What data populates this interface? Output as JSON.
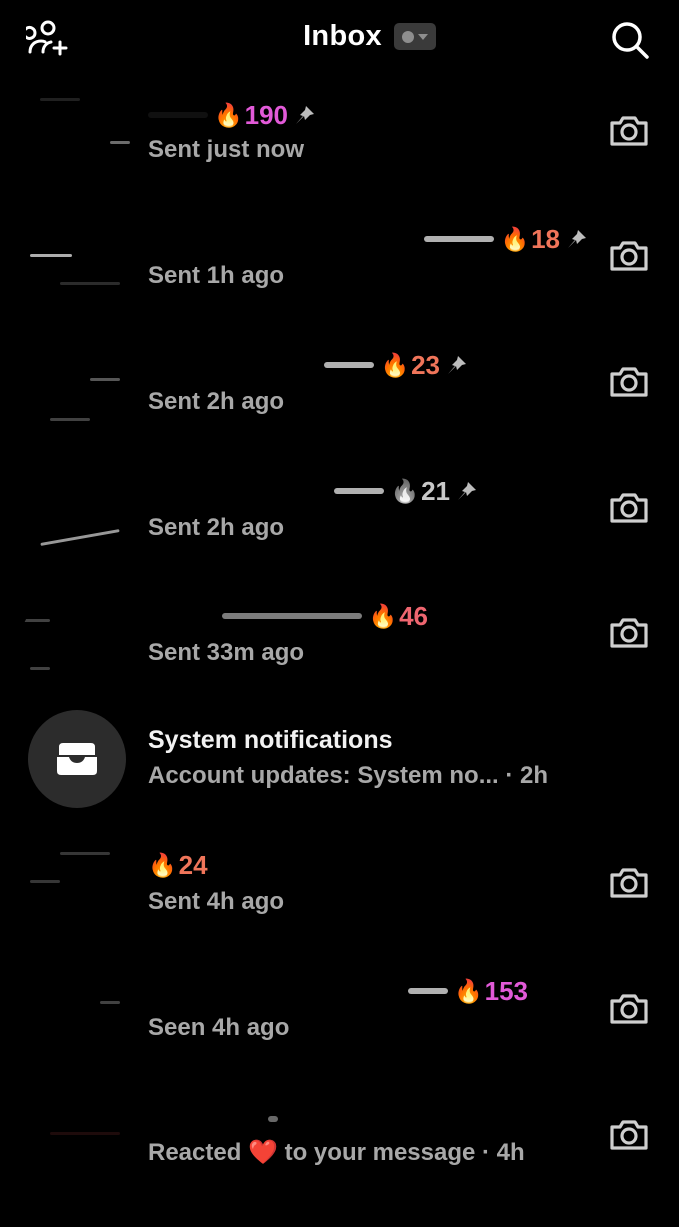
{
  "header": {
    "title": "Inbox",
    "icons": {
      "left": "add-friends-icon",
      "status": "online-status-dropdown",
      "right": "search-icon"
    }
  },
  "colors": {
    "background": "#000000",
    "secondary_text": "#a8a8a8",
    "streak_pink": "#e25ad8",
    "streak_orange": "#f0755a",
    "streak_coral": "#ef6670",
    "streak_gray": "#c8c8c8"
  },
  "conversations": [
    {
      "streak": "190",
      "streak_color": "#e25ad8",
      "flame": "🔥",
      "pinned": true,
      "status": "Sent just now",
      "camera": true
    },
    {
      "streak": "18",
      "streak_color": "#f0755a",
      "flame": "🔥",
      "pinned": true,
      "status": "Sent 1h ago",
      "camera": true
    },
    {
      "streak": "23",
      "streak_color": "#f0755a",
      "flame": "🔥",
      "pinned": true,
      "status": "Sent 2h ago",
      "camera": true
    },
    {
      "streak": "21",
      "streak_color": "#c8c8c8",
      "flame": "🔥",
      "pinned": true,
      "status": "Sent 2h ago",
      "camera": true
    },
    {
      "streak": "46",
      "streak_color": "#ef6670",
      "flame": "🔥",
      "pinned": false,
      "status": "Sent 33m ago",
      "camera": true
    }
  ],
  "system": {
    "title": "System notifications",
    "subtitle": "Account updates: System no...",
    "time": "· 2h"
  },
  "conversations_after": [
    {
      "streak": "24",
      "streak_color": "#f0755a",
      "flame": "🔥",
      "pinned": false,
      "status": "Sent 4h ago",
      "camera": true
    },
    {
      "streak": "153",
      "streak_color": "#e25ad8",
      "flame": "🔥",
      "pinned": false,
      "status": "Seen 4h ago",
      "camera": true
    }
  ],
  "last": {
    "prefix": "Reacted",
    "heart": "❤️",
    "suffix": "to your message · 4h"
  }
}
